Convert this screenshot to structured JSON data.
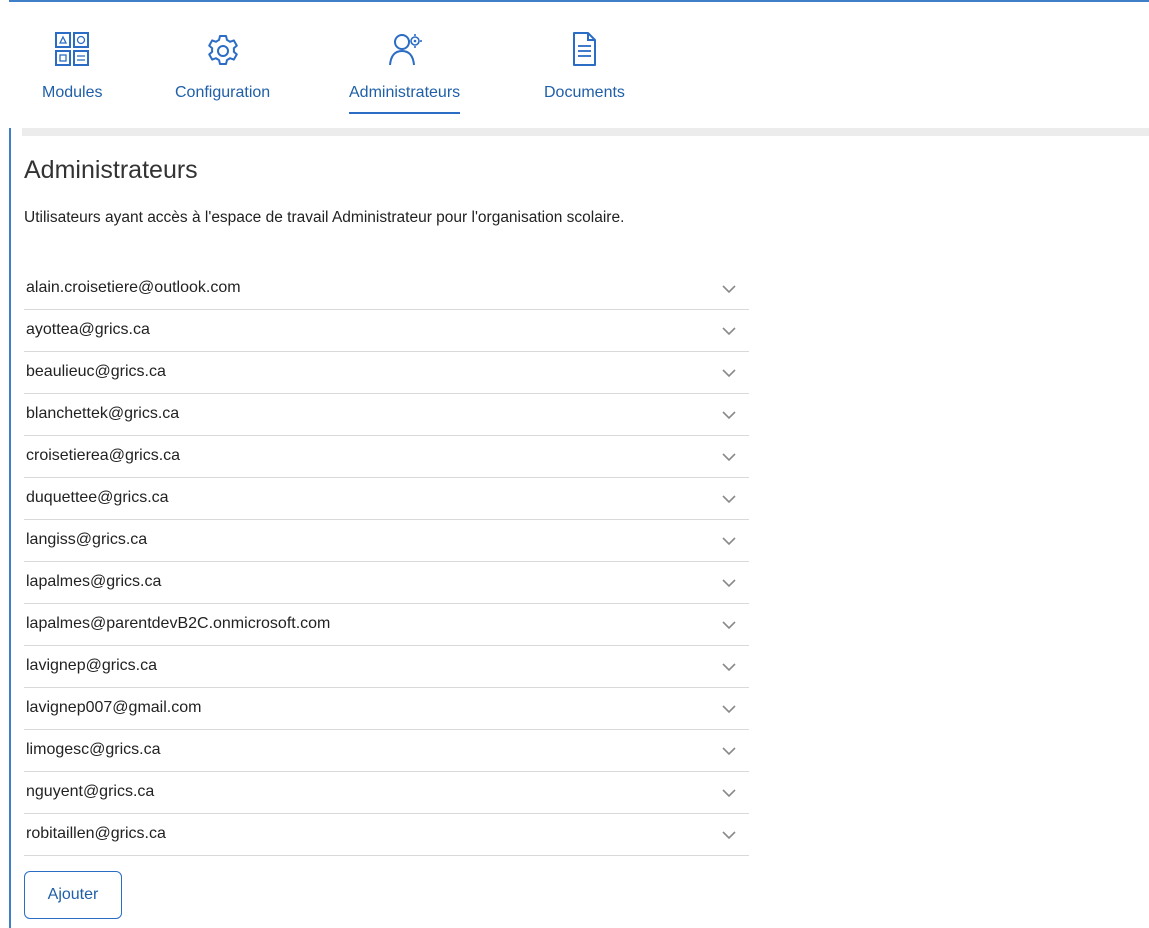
{
  "nav": {
    "items": [
      {
        "label": "Modules",
        "icon": "modules-grid-icon",
        "active": false
      },
      {
        "label": "Configuration",
        "icon": "gear-icon",
        "active": false
      },
      {
        "label": "Administrateurs",
        "icon": "admin-user-gear-icon",
        "active": true
      },
      {
        "label": "Documents",
        "icon": "document-icon",
        "active": false
      }
    ]
  },
  "main": {
    "title": "Administrateurs",
    "description": "Utilisateurs ayant accès à l'espace de travail Administrateur pour l'organisation scolaire.",
    "admins": [
      "alain.croisetiere@outlook.com",
      "ayottea@grics.ca",
      "beaulieuc@grics.ca",
      "blanchettek@grics.ca",
      "croisetierea@grics.ca",
      "duquettee@grics.ca",
      "langiss@grics.ca",
      "lapalmes@grics.ca",
      "lapalmes@parentdevB2C.onmicrosoft.com",
      "lavignep@grics.ca",
      "lavignep007@gmail.com",
      "limogesc@grics.ca",
      "nguyent@grics.ca",
      "robitaillen@grics.ca"
    ],
    "add_label": "Ajouter"
  },
  "colors": {
    "accent": "#2b6cc4",
    "link": "#1f5fa8",
    "border": "#3f7fc7"
  }
}
